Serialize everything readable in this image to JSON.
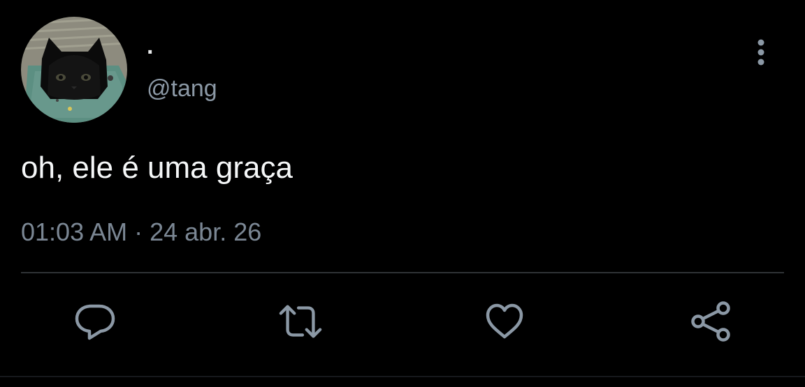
{
  "tweet": {
    "author": {
      "display_name": ".",
      "handle": "@tang",
      "avatar_icon": "black-cat-photo"
    },
    "text": "oh, ele é uma graça",
    "time": "01:03 AM",
    "separator": "·",
    "date": "24 abr. 26"
  },
  "actions": [
    {
      "name": "reply",
      "icon": "reply-bubble-icon"
    },
    {
      "name": "retweet",
      "icon": "retweet-icon"
    },
    {
      "name": "like",
      "icon": "heart-icon"
    },
    {
      "name": "share",
      "icon": "share-icon"
    }
  ],
  "colors": {
    "background": "#000000",
    "primary_text": "#e7e9ea",
    "secondary_text": "#8b98a5",
    "divider": "#2f3336",
    "icon": "#8b98a5"
  }
}
